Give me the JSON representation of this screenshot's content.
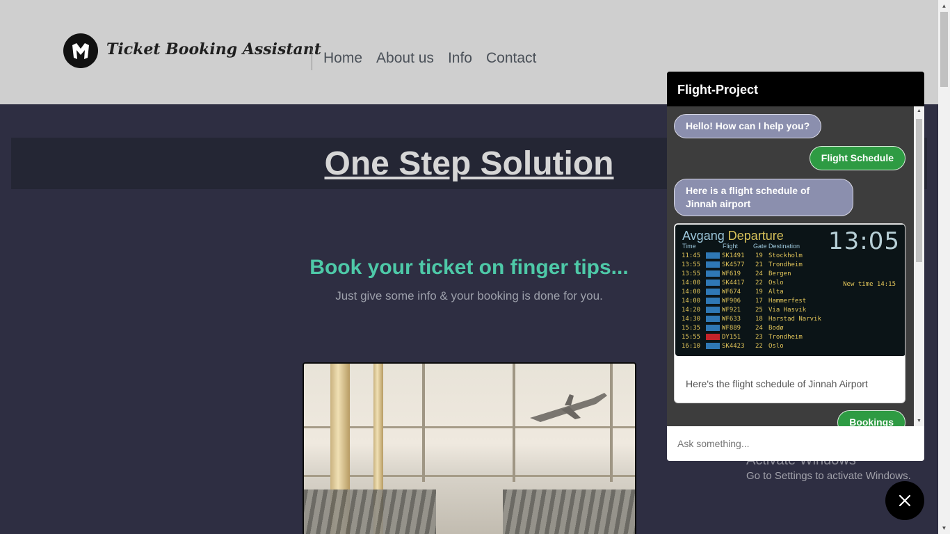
{
  "header": {
    "brand": "Ticket Booking Assistant",
    "logo_icon": "stylized-m-logo",
    "nav": [
      "Home",
      "About us",
      "Info",
      "Contact"
    ]
  },
  "hero": {
    "title": "One Step Solution",
    "tagline": "Book your ticket on finger tips...",
    "subline": "Just give some info & your booking is done for you."
  },
  "chat": {
    "title": "Flight-Project",
    "messages": [
      {
        "from": "bot",
        "text": "Hello! How can I help you?"
      },
      {
        "from": "user",
        "text": "Flight Schedule"
      },
      {
        "from": "bot",
        "text": "Here is a flight schedule of Jinnah airport"
      },
      {
        "from": "user",
        "text": "Bookings"
      }
    ],
    "card": {
      "board": {
        "label_no": "Avgang",
        "label_en": "Departure",
        "clock": "13:05",
        "col_time": "Time",
        "col_flight": "Flight",
        "col_gate_dest": "Gate Destination",
        "note": "New time 14:15",
        "rows": [
          {
            "time": "11:45",
            "flight": "SK1491",
            "gate": "19",
            "dest": "Stockholm"
          },
          {
            "time": "13:55",
            "flight": "SK4577",
            "gate": "21",
            "dest": "Trondheim"
          },
          {
            "time": "13:55",
            "flight": "WF619",
            "gate": "24",
            "dest": "Bergen"
          },
          {
            "time": "14:00",
            "flight": "SK4417",
            "gate": "22",
            "dest": "Oslo"
          },
          {
            "time": "14:00",
            "flight": "WF674",
            "gate": "19",
            "dest": "Alta"
          },
          {
            "time": "14:00",
            "flight": "WF906",
            "gate": "17",
            "dest": "Hammerfest"
          },
          {
            "time": "14:20",
            "flight": "WF921",
            "gate": "25",
            "dest": "Via Hasvik"
          },
          {
            "time": "14:30",
            "flight": "WF633",
            "gate": "18",
            "dest": "Harstad Narvik"
          },
          {
            "time": "15:35",
            "flight": "WF889",
            "gate": "24",
            "dest": "Bodø"
          },
          {
            "time": "15:55",
            "flight": "DY151",
            "gate": "23",
            "dest": "Trondheim"
          },
          {
            "time": "16:10",
            "flight": "SK4423",
            "gate": "22",
            "dest": "Oslo"
          }
        ]
      },
      "caption": "Here's the flight schedule of Jinnah Airport"
    },
    "input_placeholder": "Ask something..."
  },
  "watermark": {
    "line1": "Activate Windows",
    "line2": "Go to Settings to activate Windows."
  },
  "colors": {
    "header_bg": "#cfcfcf",
    "page_bg": "#2e2e42",
    "accent_teal": "#4ec9a8",
    "bot_bubble": "#8b8fae",
    "user_bubble": "#2e9b43",
    "chat_header": "#000000"
  }
}
